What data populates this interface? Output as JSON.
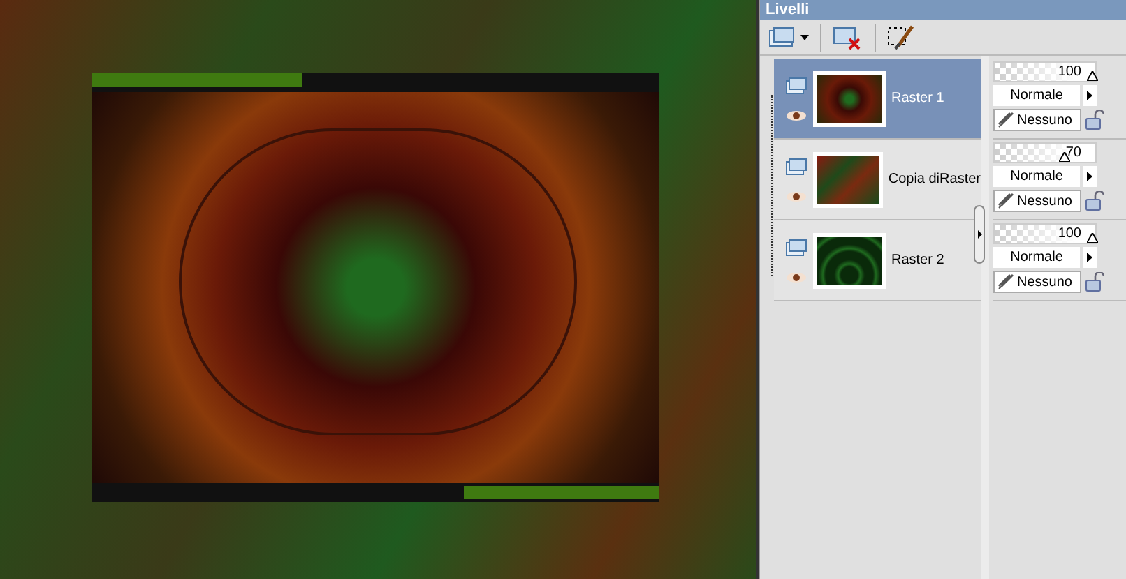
{
  "panel": {
    "title": "Livelli"
  },
  "layers": [
    {
      "name": "Raster 1",
      "selected": true,
      "opacity": "100",
      "level": 1,
      "blend": "Normale",
      "mask": "Nessuno"
    },
    {
      "name": "Copia diRaster",
      "selected": false,
      "opacity": "70",
      "level": 0.7,
      "blend": "Normale",
      "mask": "Nessuno"
    },
    {
      "name": "Raster 2",
      "selected": false,
      "opacity": "100",
      "level": 1,
      "blend": "Normale",
      "mask": "Nessuno"
    }
  ]
}
